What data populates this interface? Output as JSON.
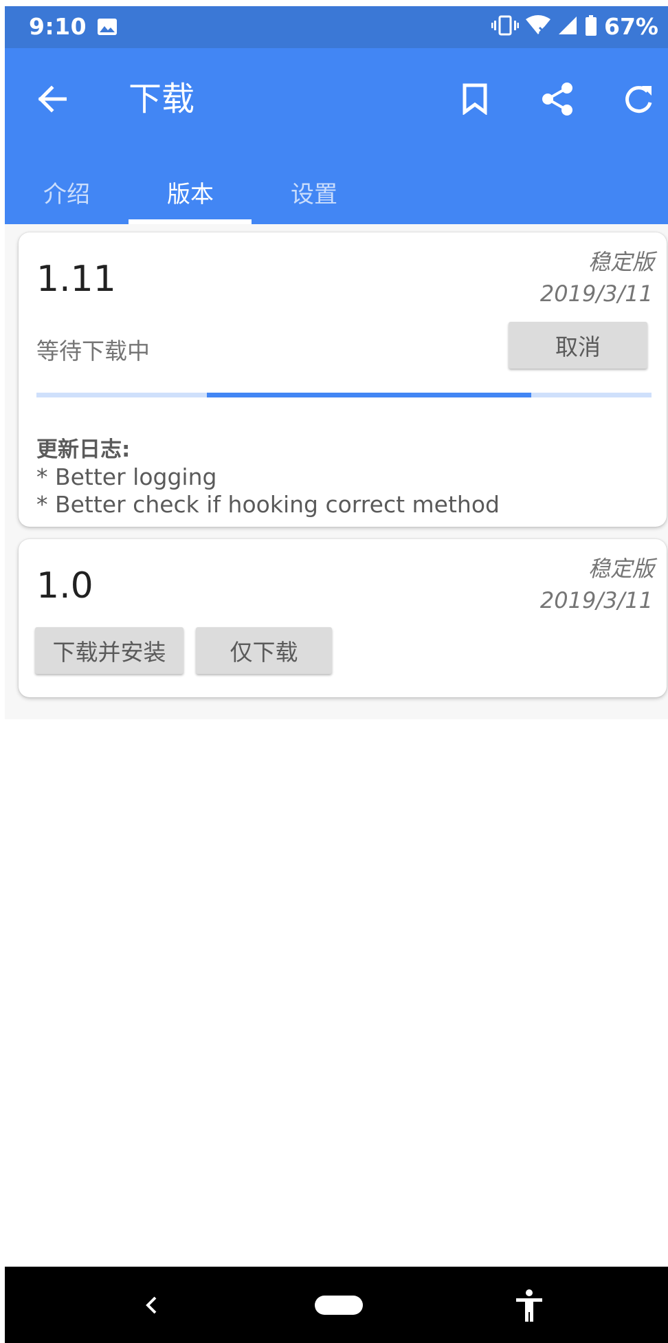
{
  "status_bar": {
    "time": "9:10",
    "battery": "67%",
    "icons": [
      "image-icon",
      "vibrate-icon",
      "wifi-icon",
      "signal-icon",
      "battery-icon"
    ]
  },
  "app_bar": {
    "title": "下载",
    "actions": [
      "bookmark-icon",
      "share-icon",
      "refresh-icon"
    ],
    "color": "#4286f4"
  },
  "tabs": [
    {
      "label": "介绍",
      "active": false
    },
    {
      "label": "版本",
      "active": true
    },
    {
      "label": "设置",
      "active": false
    }
  ],
  "versions": [
    {
      "version": "1.11",
      "channel": "稳定版",
      "date": "2019/3/11",
      "status": "等待下载中",
      "cancel_label": "取消",
      "progress": {
        "indeterminate": true
      },
      "changelog_title": "更新日志:",
      "changelog": [
        "* Better logging",
        "* Better check if hooking correct method"
      ]
    },
    {
      "version": "1.0",
      "channel": "稳定版",
      "date": "2019/3/11",
      "install_label": "下载并安装",
      "download_only_label": "仅下载"
    }
  ],
  "nav_bar": {
    "icons": [
      "back-icon",
      "home-pill",
      "accessibility-icon"
    ]
  }
}
